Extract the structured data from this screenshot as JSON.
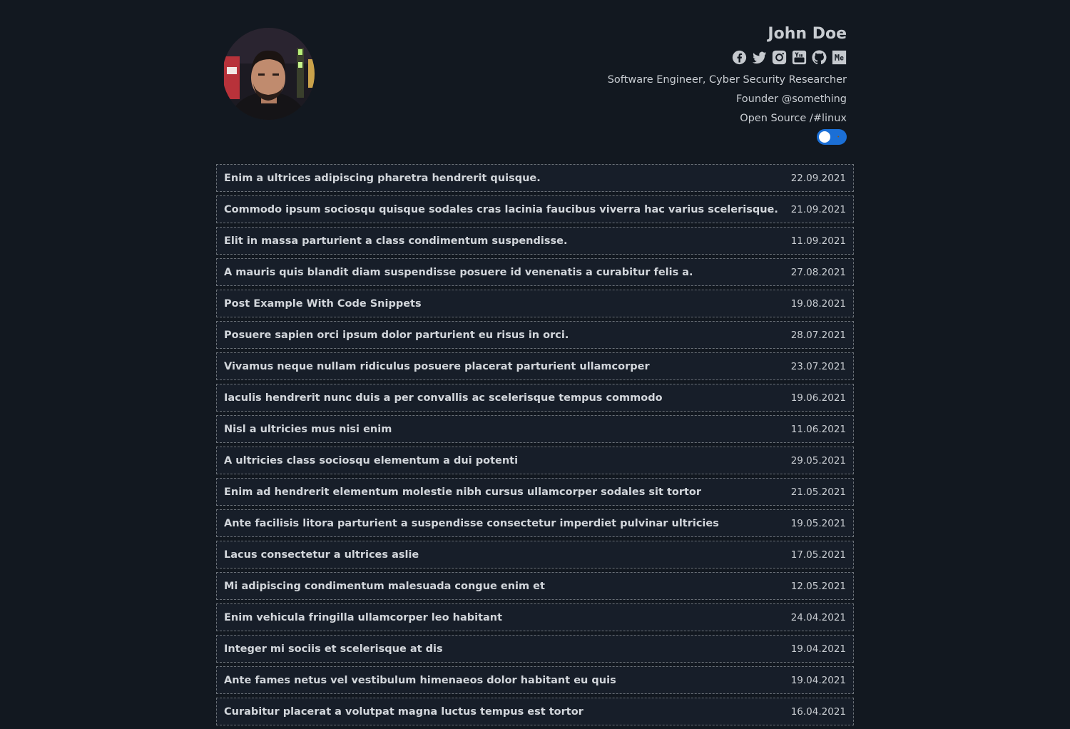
{
  "profile": {
    "name": "John Doe",
    "bio": [
      "Software Engineer, Cyber Security Researcher",
      "Founder @something",
      "Open Source /#linux"
    ],
    "socials": [
      {
        "icon": "facebook-icon"
      },
      {
        "icon": "twitter-icon"
      },
      {
        "icon": "instagram-icon"
      },
      {
        "icon": "youtube-icon"
      },
      {
        "icon": "github-icon"
      },
      {
        "icon": "behance-icon"
      }
    ],
    "theme_toggle": {
      "state": "dark",
      "icon": "moon-icon"
    }
  },
  "colors": {
    "background": "#121820",
    "card": "#171e29",
    "border": "#6b7178",
    "text": "#d2d6db",
    "accent": "#1b6fd6"
  },
  "posts": [
    {
      "title": "Enim a ultrices adipiscing pharetra hendrerit quisque.",
      "date": "22.09.2021"
    },
    {
      "title": "Commodo ipsum sociosqu quisque sodales cras lacinia faucibus viverra hac varius scelerisque.",
      "date": "21.09.2021"
    },
    {
      "title": "Elit in massa parturient a class condimentum suspendisse.",
      "date": "11.09.2021"
    },
    {
      "title": "A mauris quis blandit diam suspendisse posuere id venenatis a curabitur felis a.",
      "date": "27.08.2021"
    },
    {
      "title": "Post Example With Code Snippets",
      "date": "19.08.2021"
    },
    {
      "title": "Posuere sapien orci ipsum dolor parturient eu risus in orci.",
      "date": "28.07.2021"
    },
    {
      "title": "Vivamus neque nullam ridiculus posuere placerat parturient ullamcorper",
      "date": "23.07.2021"
    },
    {
      "title": "Iaculis hendrerit nunc duis a per convallis ac scelerisque tempus commodo",
      "date": "19.06.2021"
    },
    {
      "title": "Nisl a ultricies mus nisi enim",
      "date": "11.06.2021"
    },
    {
      "title": "A ultricies class sociosqu elementum a dui potenti",
      "date": "29.05.2021"
    },
    {
      "title": "Enim ad hendrerit elementum molestie nibh cursus ullamcorper sodales sit tortor",
      "date": "21.05.2021"
    },
    {
      "title": "Ante facilisis litora parturient a suspendisse consectetur imperdiet pulvinar ultricies",
      "date": "19.05.2021"
    },
    {
      "title": "Lacus consectetur a ultrices aslie",
      "date": "17.05.2021"
    },
    {
      "title": "Mi adipiscing condimentum malesuada congue enim et",
      "date": "12.05.2021"
    },
    {
      "title": "Enim vehicula fringilla ullamcorper leo habitant",
      "date": "24.04.2021"
    },
    {
      "title": "Integer mi sociis et scelerisque at dis",
      "date": "19.04.2021"
    },
    {
      "title": "Ante fames netus vel vestibulum himenaeos dolor habitant eu quis",
      "date": "19.04.2021"
    },
    {
      "title": "Curabitur placerat a volutpat magna luctus tempus est tortor",
      "date": "16.04.2021"
    }
  ]
}
